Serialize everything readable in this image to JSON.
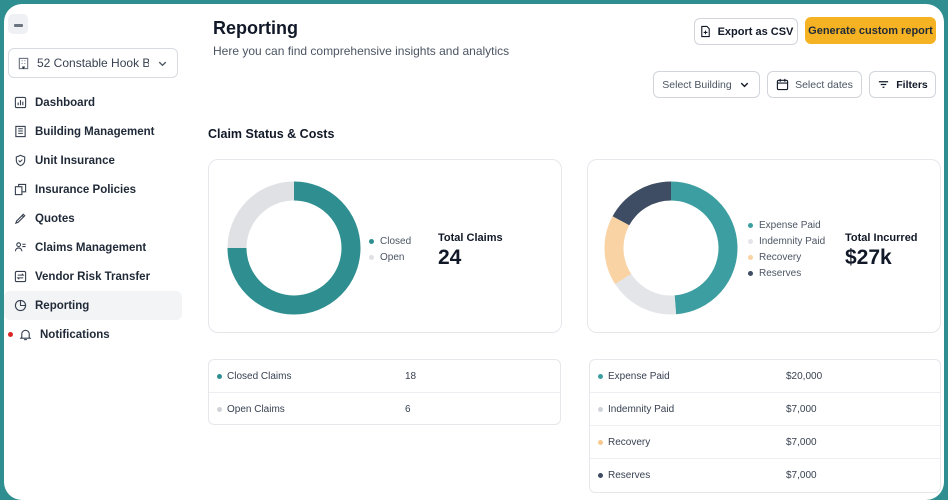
{
  "sidebar": {
    "building": "52 Constable Hook B...",
    "items": [
      {
        "label": "Dashboard",
        "icon": "dashboard-icon"
      },
      {
        "label": "Building Management",
        "icon": "building-icon"
      },
      {
        "label": "Unit Insurance",
        "icon": "shield-icon"
      },
      {
        "label": "Insurance Policies",
        "icon": "documents-icon"
      },
      {
        "label": "Quotes",
        "icon": "quote-icon"
      },
      {
        "label": "Claims Management",
        "icon": "claims-icon"
      },
      {
        "label": "Vendor Risk Transfer",
        "icon": "transfer-icon"
      },
      {
        "label": "Reporting",
        "icon": "pie-icon"
      },
      {
        "label": "Notifications",
        "icon": "bell-icon"
      }
    ]
  },
  "header": {
    "title": "Reporting",
    "subtitle": "Here you can find comprehensive insights and analytics",
    "export_label": "Export as CSV",
    "generate_label": "Generate custom report"
  },
  "filters": {
    "building": "Select Building",
    "dates": "Select dates",
    "filters": "Filters"
  },
  "section_title": "Claim Status & Costs",
  "claims_card": {
    "metric_label": "Total Claims",
    "metric_value": "24",
    "legend": [
      {
        "label": "Closed",
        "color": "#2f8f90"
      },
      {
        "label": "Open",
        "color": "#dfe1e4"
      }
    ]
  },
  "incurred_card": {
    "metric_label": "Total Incurred",
    "metric_value": "$27k",
    "legend": [
      {
        "label": "Expense Paid",
        "color": "#3c9ea0"
      },
      {
        "label": "Indemnity Paid",
        "color": "#e3e5e8"
      },
      {
        "label": "Recovery",
        "color": "#f9d3a4"
      },
      {
        "label": "Reserves",
        "color": "#3e4d63"
      }
    ]
  },
  "claims_table": [
    {
      "label": "Closed Claims",
      "value": "18",
      "color": "#2f8f90"
    },
    {
      "label": "Open Claims",
      "value": "6",
      "color": "#cfd3d8"
    }
  ],
  "incurred_table": [
    {
      "label": "Expense Paid",
      "value": "$20,000",
      "color": "#3c9ea0"
    },
    {
      "label": "Indemnity Paid",
      "value": "$7,000",
      "color": "#cfd3d8"
    },
    {
      "label": "Recovery",
      "value": "$7,000",
      "color": "#f5c98f"
    },
    {
      "label": "Reserves",
      "value": "$7,000",
      "color": "#3e4d63"
    }
  ],
  "chart_data": [
    {
      "type": "pie",
      "title": "",
      "labels": [
        "Closed",
        "Open"
      ],
      "values": [
        18,
        6
      ],
      "colors": [
        "#2f8f90",
        "#dfe1e4"
      ]
    },
    {
      "type": "pie",
      "title": "",
      "labels": [
        "Expense Paid",
        "Indemnity Paid",
        "Recovery",
        "Reserves"
      ],
      "values": [
        20000,
        7000,
        7000,
        7000
      ],
      "colors": [
        "#3c9ea0",
        "#e3e5e8",
        "#f9d3a4",
        "#3e4d63"
      ]
    }
  ]
}
